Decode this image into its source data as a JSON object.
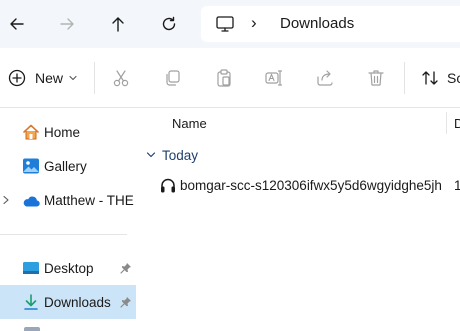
{
  "address_bar": {
    "location_icon": "this-pc-icon",
    "breadcrumb_separator": "›",
    "current_folder": "Downloads"
  },
  "toolbar": {
    "new_label": "New",
    "sort_label": "Sc"
  },
  "nav_pane": {
    "items": [
      {
        "label": "Home",
        "icon": "home-icon"
      },
      {
        "label": "Gallery",
        "icon": "gallery-icon"
      },
      {
        "label": "Matthew - THE S",
        "icon": "onedrive-cloud-icon"
      },
      {
        "label": "Desktop",
        "icon": "desktop-folder-icon"
      },
      {
        "label": "Downloads",
        "icon": "downloads-folder-icon",
        "selected": true
      }
    ]
  },
  "file_list": {
    "columns": [
      "Name",
      "D"
    ],
    "groups": [
      {
        "label": "Today",
        "files": [
          {
            "name": "bomgar-scc-s120306ifwx5y5d6wgyidghe5jh...",
            "date_partial": "1",
            "icon": "headset-app-icon"
          }
        ]
      }
    ]
  },
  "colors": {
    "accent": "#0067c0",
    "selection": "#cce4f7",
    "nav_background": "#f3f6fb"
  }
}
